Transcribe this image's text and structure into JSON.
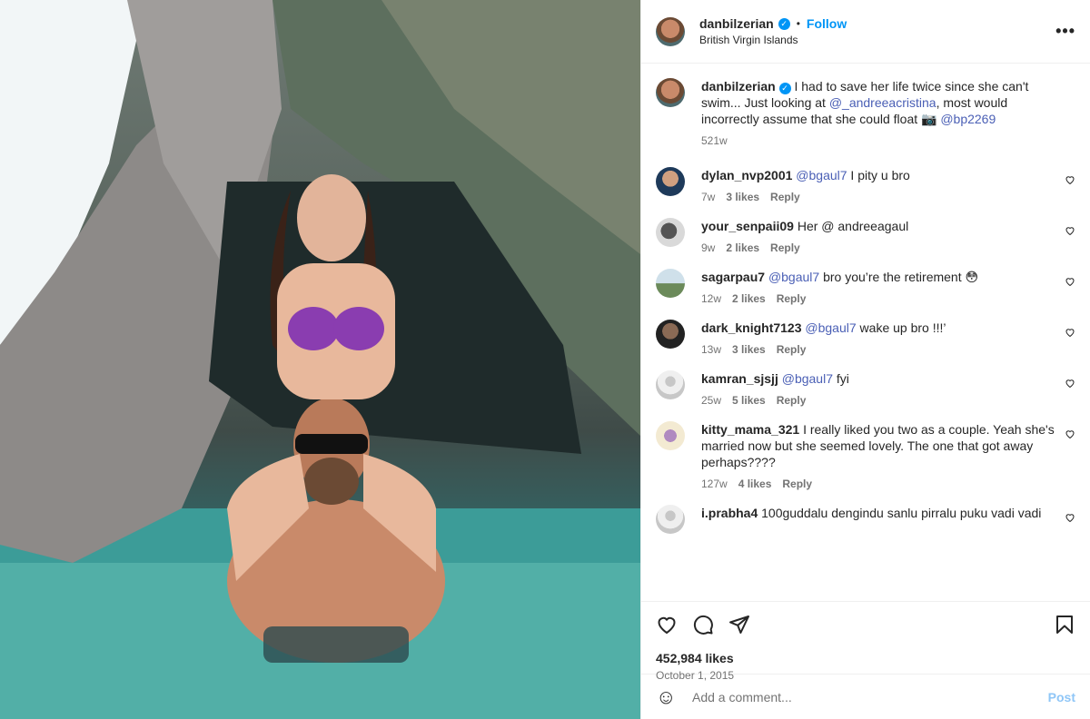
{
  "header": {
    "username": "danbilzerian",
    "follow_label": "Follow",
    "location": "British Virgin Islands",
    "separator": "•"
  },
  "caption": {
    "username": "danbilzerian",
    "text_part1": "I had to save her life twice since she can't swim... Just looking at",
    "mention1": "@_andreeacristina",
    "text_part2": ", most would incorrectly assume that she could float 📷",
    "mention2": "@bp2269",
    "time": "521w"
  },
  "comments": [
    {
      "user": "dylan_nvp2001",
      "mention": "@bgaul7",
      "text": " I pity u bro",
      "time": "7w",
      "likes": "3 likes",
      "reply": "Reply"
    },
    {
      "user": "your_senpaii09",
      "mention": "",
      "text": "Her @ andreeagaul",
      "time": "9w",
      "likes": "2 likes",
      "reply": "Reply"
    },
    {
      "user": "sagarpau7",
      "mention": "@bgaul7",
      "text": " bro you’re the retirement 😳",
      "time": "12w",
      "likes": "2 likes",
      "reply": "Reply"
    },
    {
      "user": "dark_knight7123",
      "mention": "@bgaul7",
      "text": " wake up bro !!!’",
      "time": "13w",
      "likes": "3 likes",
      "reply": "Reply"
    },
    {
      "user": "kamran_sjsjj",
      "mention": "@bgaul7",
      "text": " fyi",
      "time": "25w",
      "likes": "5 likes",
      "reply": "Reply"
    },
    {
      "user": "kitty_mama_321",
      "mention": "",
      "text": "I really liked you two as a couple. Yeah she's married now but she seemed lovely. The one that got away perhaps????",
      "time": "127w",
      "likes": "4 likes",
      "reply": "Reply"
    },
    {
      "user": "i.prabha4",
      "mention": "",
      "text": "100guddalu dengindu sanlu pirralu puku vadi vadi",
      "time": "",
      "likes": "",
      "reply": ""
    }
  ],
  "stats": {
    "likes": "452,984 likes",
    "date": "October 1, 2015"
  },
  "composer": {
    "placeholder": "Add a comment...",
    "post_label": "Post",
    "emoji_icon": "☺"
  },
  "icons": {
    "verified": "✓",
    "more": "•••"
  },
  "colors": {
    "accent": "#0095f6",
    "mention": "#4a5fb5",
    "muted": "#737373",
    "border": "#efefef"
  }
}
